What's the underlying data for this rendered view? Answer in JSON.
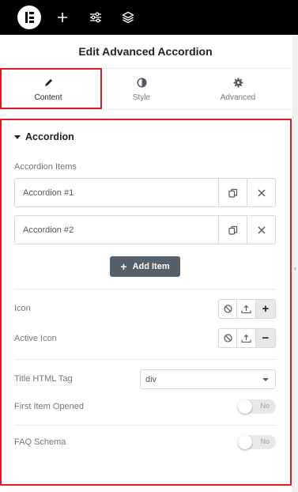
{
  "toolbar": {
    "icons": [
      "elementor-logo-icon",
      "plus-icon",
      "sliders-icon",
      "layers-icon"
    ]
  },
  "panel": {
    "title": "Edit Advanced Accordion"
  },
  "tabs": [
    {
      "label": "Content",
      "icon": "pencil-icon",
      "active": true
    },
    {
      "label": "Style",
      "icon": "half-circle-icon",
      "active": false
    },
    {
      "label": "Advanced",
      "icon": "gear-icon",
      "active": false
    }
  ],
  "section": {
    "title": "Accordion"
  },
  "accordion_items_label": "Accordion Items",
  "items": [
    {
      "title": "Accordion #1"
    },
    {
      "title": "Accordion #2"
    }
  ],
  "add_item_label": "Add Item",
  "icon_control": {
    "label": "Icon",
    "active_option": "+"
  },
  "active_icon_control": {
    "label": "Active Icon",
    "active_option": "−"
  },
  "title_tag": {
    "label": "Title HTML Tag",
    "value": "div"
  },
  "first_item_opened": {
    "label": "First Item Opened",
    "state": "No"
  },
  "faq_schema": {
    "label": "FAQ Schema",
    "state": "No"
  },
  "colors": {
    "highlight": "#e01b24",
    "button": "#556068",
    "toolbar": "#000000"
  }
}
